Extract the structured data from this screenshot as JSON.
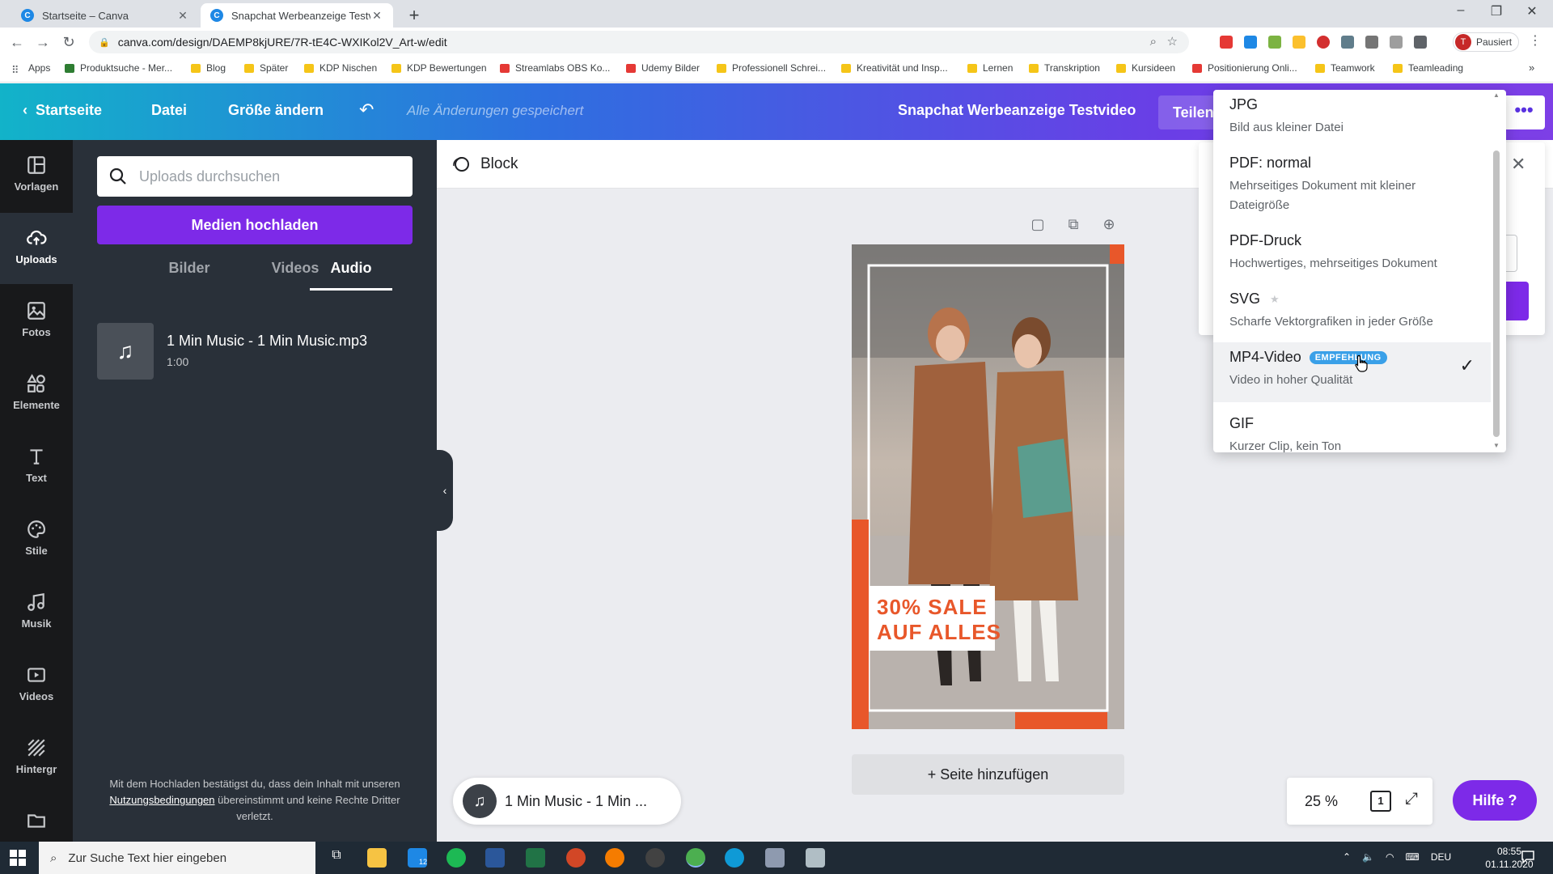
{
  "browser": {
    "tabs": [
      {
        "title": "Startseite – Canva",
        "active": false
      },
      {
        "title": "Snapchat Werbeanzeige Testvide",
        "active": true
      }
    ],
    "url": "canva.com/design/DAEMP8kjURE/7R-tE4C-WXIKol2V_Art-w/edit",
    "profile_label": "Pausiert",
    "profile_initial": "T",
    "bookmarks": [
      "Apps",
      "Produktsuche - Mer...",
      "Blog",
      "Später",
      "KDP Nischen",
      "KDP Bewertungen",
      "Streamlabs OBS Ko...",
      "Udemy Bilder",
      "Professionell Schrei...",
      "Kreativität und Insp...",
      "Lernen",
      "Transkription",
      "Kursideen",
      "Positionierung Onli...",
      "Teamwork",
      "Teamleading"
    ]
  },
  "header": {
    "home": "Startseite",
    "file": "Datei",
    "resize": "Größe ändern",
    "saved": "Alle Änderungen gespeichert",
    "design_title": "Snapchat Werbeanzeige Testvideo",
    "share": "Teilen"
  },
  "rail": [
    {
      "label": "Vorlagen",
      "icon": "template-icon"
    },
    {
      "label": "Uploads",
      "icon": "upload-icon"
    },
    {
      "label": "Fotos",
      "icon": "photo-icon"
    },
    {
      "label": "Elemente",
      "icon": "elements-icon"
    },
    {
      "label": "Text",
      "icon": "text-icon"
    },
    {
      "label": "Stile",
      "icon": "palette-icon"
    },
    {
      "label": "Musik",
      "icon": "music-icon"
    },
    {
      "label": "Videos",
      "icon": "video-icon"
    },
    {
      "label": "Hintergr",
      "icon": "background-icon"
    }
  ],
  "panel": {
    "search_placeholder": "Uploads durchsuchen",
    "upload_button": "Medien hochladen",
    "tabs": [
      "Bilder",
      "Videos",
      "Audio"
    ],
    "active_tab": "Audio",
    "audio": {
      "name": "1 Min Music - 1 Min Music.mp3",
      "duration": "1:00"
    },
    "terms_pre": "Mit dem Hochladen bestätigst du, dass dein Inhalt mit unseren",
    "terms_link": "Nutzungsbedingungen",
    "terms_post": "übereinstimmt und keine Rechte Dritter verletzt."
  },
  "toolbar": {
    "animation": "Block"
  },
  "design": {
    "sale_line1": "30% SALE",
    "sale_line2": "AUF ALLES",
    "accent_color": "#e8572a"
  },
  "canvas": {
    "add_page": "+ Seite hinzufügen",
    "music_pill": "1 Min Music - 1 Min ...",
    "zoom": "25 %",
    "page_count": "1",
    "help": "Hilfe ?"
  },
  "dropdown": {
    "options": [
      {
        "title": "JPG",
        "desc": "Bild aus kleiner Datei"
      },
      {
        "title": "PDF: normal",
        "desc": "Mehrseitiges Dokument mit kleiner Dateigröße"
      },
      {
        "title": "PDF-Druck",
        "desc": "Hochwertiges, mehrseitiges Dokument"
      },
      {
        "title": "SVG",
        "desc": "Scharfe Vektorgrafiken in jeder Größe",
        "premium": true
      },
      {
        "title": "MP4-Video",
        "desc": "Video in hoher Qualität",
        "badge": "EMPFEHLUNG",
        "selected": true
      },
      {
        "title": "GIF",
        "desc": "Kurzer Clip, kein Ton"
      }
    ]
  },
  "taskbar": {
    "search_placeholder": "Zur Suche Text hier eingeben",
    "language": "DEU",
    "time": "08:55",
    "date": "01.11.2020",
    "mail_badge": "12"
  },
  "colors": {
    "canva_purple": "#7d2ae8",
    "panel_bg": "#293039",
    "rail_bg": "#18191b",
    "badge_blue": "#3aa0e8"
  }
}
